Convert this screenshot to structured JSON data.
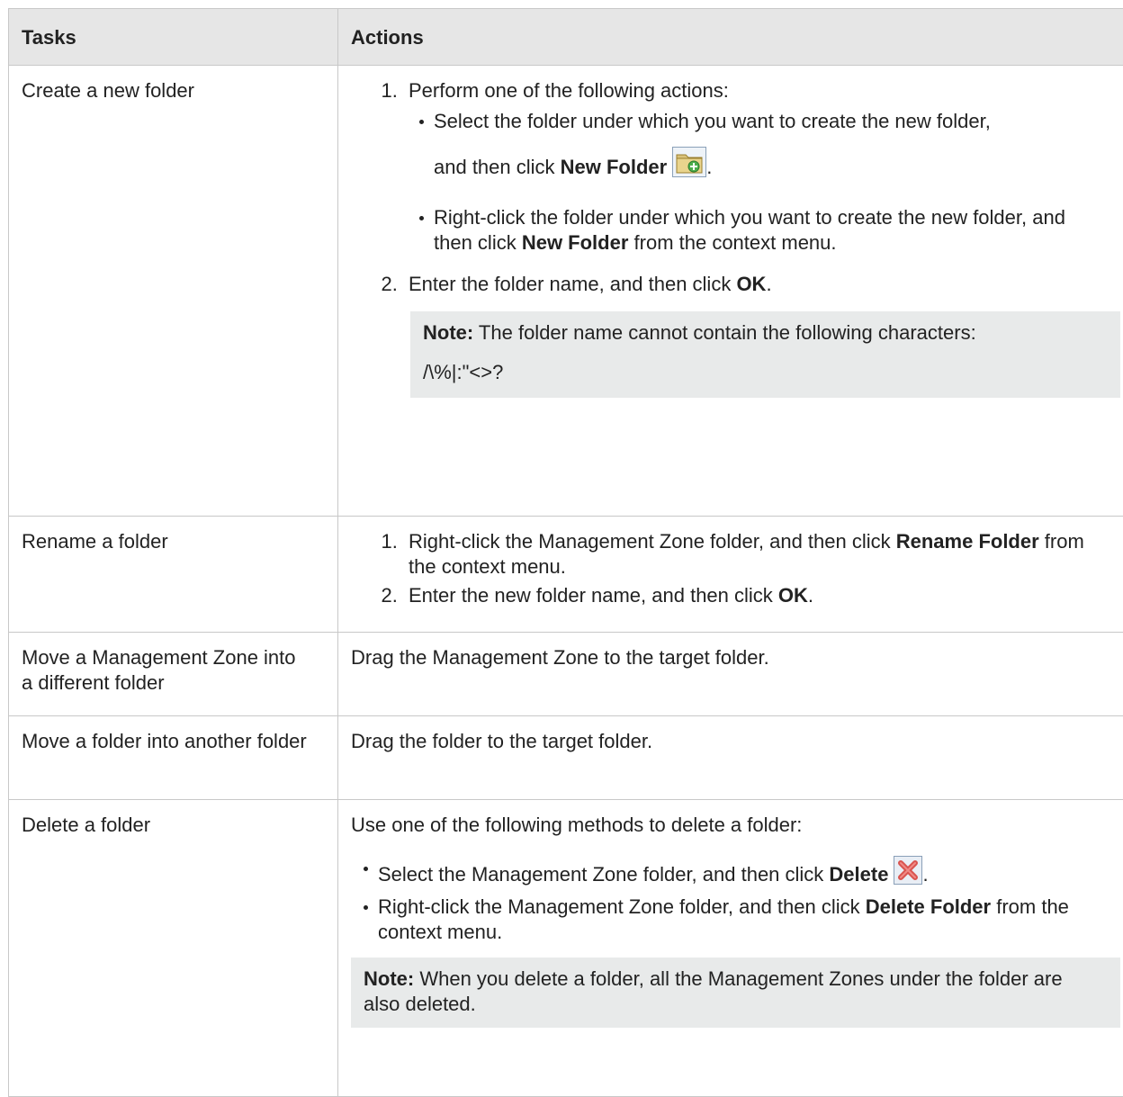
{
  "headers": {
    "tasks": "Tasks",
    "actions": "Actions"
  },
  "rows": {
    "create": {
      "task": "Create a new folder",
      "step1": "Perform one of the following actions:",
      "b1_text": "Select the folder under which you want to create the new folder,",
      "b1_text2": "and then click ",
      "b1_bold": "New Folder",
      "b1_icon": "new-folder-icon",
      "b2_text": "Right-click the folder under which you want to create the new folder, and then click ",
      "b2_bold": "New Folder",
      "b2_tail": " from the context menu.",
      "step2_text": "Enter the folder name, and then click ",
      "step2_bold": "OK",
      "note_label": "Note:",
      "note_text": " The folder name cannot contain the following characters:",
      "note_chars": "/\\%|:\"<>?"
    },
    "rename": {
      "task": "Rename a folder",
      "step1_text": "Right-click the Management Zone folder, and then click ",
      "step1_bold": "Rename Folder",
      "step1_tail": " from the context menu.",
      "step2_text": "Enter the new folder name, and then click ",
      "step2_bold": "OK"
    },
    "move_zone": {
      "task": "Move a Management Zone into a different folder",
      "action": "Drag the Management Zone to the target folder."
    },
    "move_folder": {
      "task": "Move a folder into another folder",
      "action": "Drag the folder to the target folder."
    },
    "delete": {
      "task": "Delete a folder",
      "intro": "Use one of the following methods to delete a folder:",
      "b1_text": "Select the Management Zone folder, and then click ",
      "b1_bold": "Delete",
      "b1_icon": "delete-icon",
      "b2_text": "Right-click the Management Zone folder, and then click ",
      "b2_bold": "Delete Folder",
      "b2_tail": " from the context menu.",
      "note_label": "Note:",
      "note_text": " When you delete a folder, all the Management Zones under the folder are also deleted."
    }
  }
}
